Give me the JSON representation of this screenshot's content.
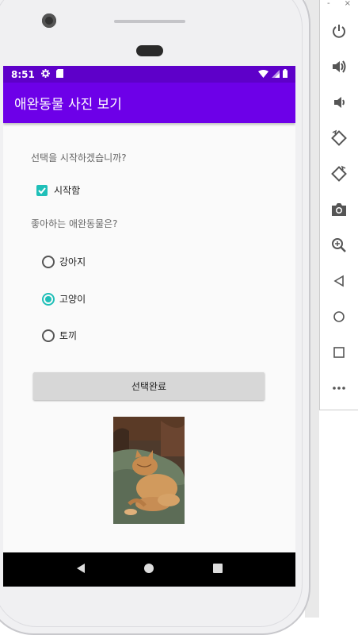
{
  "status_bar": {
    "time": "8:51"
  },
  "app_bar": {
    "title": "애완동물 사진 보기"
  },
  "form": {
    "question1": "선택을 시작하겠습니까?",
    "start_checkbox_label": "시작함",
    "start_checked": true,
    "question2": "좋아하는 애완동물은?",
    "options": [
      {
        "label": "강아지",
        "selected": false
      },
      {
        "label": "고양이",
        "selected": true
      },
      {
        "label": "토끼",
        "selected": false
      }
    ],
    "submit_label": "선택완료"
  },
  "colors": {
    "status_bar": "#5e00c9",
    "app_bar": "#6d00e8",
    "accent": "#1fbfb8",
    "button": "#d7d7d7"
  },
  "emulator_sidebar": {
    "top_controls": [
      "-",
      "×"
    ],
    "buttons": [
      "power-icon",
      "volume-up-icon",
      "volume-down-icon",
      "rotate-left-icon",
      "rotate-right-icon",
      "camera-icon",
      "zoom-icon",
      "back-icon",
      "home-icon",
      "overview-icon",
      "more-icon"
    ]
  }
}
